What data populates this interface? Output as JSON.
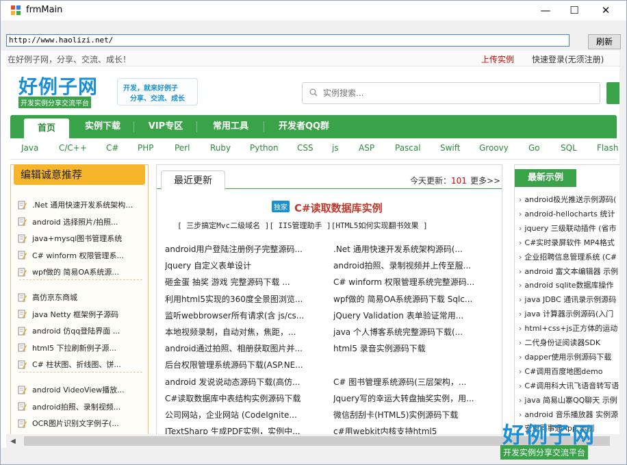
{
  "window": {
    "title": "frmMain",
    "minimize": "—",
    "maximize": "☐",
    "close": "✕"
  },
  "toolbar": {
    "address_value": "http://www.haolizi.net/",
    "refresh_label": "刷新"
  },
  "site": {
    "welcome": "在好例子网，分享、交流、成长！",
    "upload_link": "上传实例",
    "login_link": "快速登录(无须注册)",
    "logo": "好例子网",
    "logo_sub": "开发实例分享交流平台",
    "slogan_line1": "开发，就来好例子",
    "slogan_line2": "分享、交流、成长",
    "search_placeholder": "实例搜索...",
    "nav": [
      "首页",
      "实例下载",
      "VIP专区",
      "常用工具",
      "开发者QQ群"
    ],
    "langs": [
      "Java",
      "C/C++",
      "C#",
      "PHP",
      "Perl",
      "Ruby",
      "Python",
      "CSS",
      "js",
      "ASP",
      "Pascal",
      "Swift",
      "Groovy",
      "Go",
      "SQL",
      "Flash"
    ]
  },
  "left_panel": {
    "title": "编辑诚意推荐",
    "groups": [
      [
        ".Net 通用快速开发系统架构源码(...",
        "android 选择照片/拍照...",
        "java+mysql图书管理系统",
        "C# winform 权限管理系...",
        "wpf做的 简易OA系统源..."
      ],
      [
        "高仿京东商城",
        "java Netty 框架例子源码",
        "android 仿qq登陆界面 ...",
        "html5 下拉刷新例子源...",
        "C# 柱状图、折线图、饼..."
      ],
      [
        "android VideoView播放...",
        "android拍照、录制视频...",
        "OCR图片识别文字例子(..."
      ]
    ]
  },
  "center_panel": {
    "tab": "最近更新",
    "today_label": "今天更新：",
    "today_count": "101",
    "more": "更多>>",
    "feat_badge": "独家",
    "feat_title": "C#读取数据库实例",
    "feat_links": "[  三步搞定Mvc二级域名  ][    IIS管理助手    ][HTML5如何实现翻书效果 ]",
    "rows": [
      [
        "android用户登陆注册例子完整源码...",
        ".Net 通用快速开发系统架构源码(..."
      ],
      [
        " Jquery 自定义表单设计",
        "android拍照、录制视频并上传至服..."
      ],
      [
        "砸金蛋 抽奖 游戏 完整源码下载 ...",
        "C# winform 权限管理系统完整源码..."
      ],
      [
        "利用html5实现的360度全景图浏览...",
        "wpf做的 简易OA系统源码下载 Sqlc..."
      ],
      [
        "监听webbrowser所有请求(含 js/cs...",
        "jQuery Validation 表单验证常用..."
      ],
      [
        "本地视频录制，自动对焦，焦距，...",
        "java 个人博客系统完整源码下载(..."
      ],
      [
        "android通过拍照、相册获取图片并...",
        " html5 录音实例源码下载"
      ],
      [
        "后台权限管理系统源码下载(ASP.NE...",
        ""
      ],
      [
        "android 发说说动态源码下载(高仿...",
        "C# 图书管理系统源码(三层架构，..."
      ],
      [
        "C#读取数据库中表结构实例源码下载",
        "Jquery写的幸运大转盘抽奖实例，用..."
      ],
      [
        "公司网站，企业网站 (CodeIgnite...",
        " 微信刮刮卡(HTML5)实例源码下载"
      ],
      [
        "ITextSharp 生成PDF实例，实例中...",
        " c#用webkit内核支持html5"
      ]
    ]
  },
  "right_panel": {
    "title": "最新示例",
    "items": [
      "android极光推送示例源码(",
      "android-hellocharts 统计",
      "jquery 三级联动插件 (省市",
      "C#实时录屏软件 MP4格式",
      "企业招聘信息管理系统 (C#",
      "android 富文本编辑器 示例",
      "android sqlite数据库操作",
      "java JDBC 通讯录示例源码",
      "java 计算器示例源码(入门",
      "html+css+js正方体的运动",
      "二代身份证阅读器SDK",
      "dapper使用示例源码下载",
      "C#调用百度地图demo",
      "C#调用科大讯飞语音转写语",
      "java 简易山寨QQ聊天 示例",
      "android 音乐播放器 实例源",
      "安卓同事通App 示例"
    ]
  },
  "watermark": {
    "text": "好例子网",
    "sub": "开发实例分享交流平台"
  },
  "colors": {
    "brand_green": "#3aa34a",
    "brand_blue": "#1a8fd6",
    "recommend_orange": "#f7b52c",
    "highlight_red": "#d40000"
  }
}
